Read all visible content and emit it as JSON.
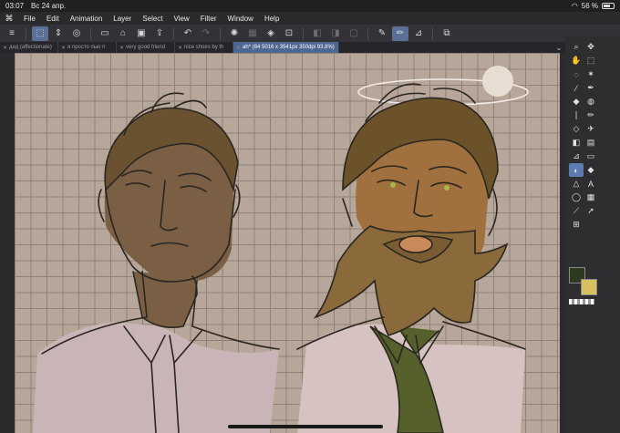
{
  "status": {
    "time": "03:07",
    "date": "Вс 24 апр.",
    "battery": "56 %",
    "battery_level": 0.56
  },
  "menu": [
    "File",
    "Edit",
    "Animation",
    "Layer",
    "Select",
    "View",
    "Filter",
    "Window",
    "Help"
  ],
  "tabs": [
    {
      "label": "дед (affectionate)"
    },
    {
      "label": "я просто пью n"
    },
    {
      "label": "very good friend"
    },
    {
      "label": "nice shoes by th"
    },
    {
      "label": "ah* (84 5016 x 3541px 350dpi 93.8%)",
      "active": true
    }
  ],
  "colors": {
    "accent": "#5a6f96",
    "main_color": "#2e3a1f",
    "sub_color": "#d8c060",
    "canvas": "#b7a79b"
  },
  "icons": {
    "app_logo": "clip-studio-logo",
    "toolbar": [
      "menu-icon",
      "select-layer-icon",
      "spinner-icon",
      "fill-icon",
      "new-file-icon",
      "open-folder-icon",
      "save-icon",
      "export-icon",
      "undo-icon",
      "redo-icon",
      "lasso-spin-icon",
      "clear-icon",
      "fill-bucket-icon",
      "transform-icon",
      "ruler-pen-icon",
      "pen-icon",
      "pencil-icon",
      "copy-icon"
    ],
    "tools": [
      "zoom-icon",
      "move-icon",
      "hand-icon",
      "marquee-icon",
      "lasso-icon",
      "magic-wand-icon",
      "eyedropper-icon",
      "pen-icon",
      "drop-icon",
      "blur-icon",
      "brush-icon",
      "pencil-icon",
      "eraser-icon",
      "airbrush-icon",
      "fill-icon",
      "gradient-icon",
      "ruler-icon",
      "rect-icon",
      "highlight-icon",
      "marker-icon",
      "figure-icon",
      "text-icon",
      "balloon-icon",
      "frame-icon",
      "line-icon",
      "select-arrow-icon",
      "transform-icon"
    ]
  }
}
